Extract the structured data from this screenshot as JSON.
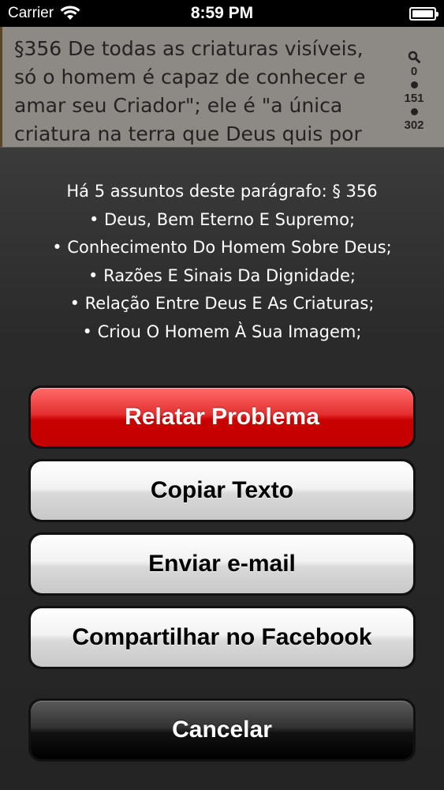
{
  "status_bar": {
    "carrier": "Carrier",
    "time": "8:59 PM",
    "wifi_icon": "wifi-icon",
    "battery_icon": "battery-icon"
  },
  "document": {
    "text": "§356 De todas as criaturas visíveis, só o homem é capaz de conhecer e amar seu Criador\"; ele é \"a única criatura na terra que Deus quis por",
    "side_search_icon": "search-icon",
    "side_counts": [
      "0",
      "151",
      "302"
    ]
  },
  "sheet": {
    "title_lines": [
      "Há 5 assuntos deste parágrafo: § 356",
      "• Deus, Bem Eterno E Supremo;",
      "• Conhecimento Do Homem Sobre Deus;",
      "• Razões E Sinais Da Dignidade;",
      "• Relação Entre Deus E As Criaturas;",
      "• Criou O Homem À Sua Imagem;"
    ],
    "buttons": {
      "report": "Relatar Problema",
      "copy": "Copiar Texto",
      "email": "Enviar e-mail",
      "facebook": "Compartilhar no Facebook",
      "cancel": "Cancelar"
    }
  },
  "colors": {
    "destructive_red": "#d40000",
    "sheet_background": "#2b2b2b"
  }
}
